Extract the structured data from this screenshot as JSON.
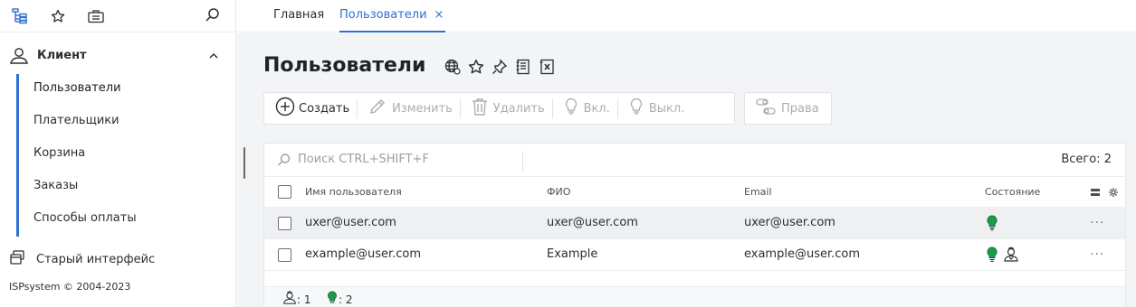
{
  "sidebar": {
    "section_label": "Клиент",
    "items": [
      {
        "label": "Пользователи"
      },
      {
        "label": "Плательщики"
      },
      {
        "label": "Корзина"
      },
      {
        "label": "Заказы"
      },
      {
        "label": "Способы оплаты"
      }
    ],
    "old_interface_label": "Старый интерфейс",
    "copyright": "ISPsystem © 2004-2023"
  },
  "tabs": {
    "home_label": "Главная",
    "users_label": "Пользователи",
    "close_symbol": "×"
  },
  "page": {
    "title": "Пользователи"
  },
  "toolbar": {
    "create": "Создать",
    "edit": "Изменить",
    "delete": "Удалить",
    "enable": "Вкл.",
    "disable": "Выкл.",
    "rights": "Права"
  },
  "table": {
    "search_placeholder": "Поиск CTRL+SHIFT+F",
    "total_label": "Всего: 2",
    "columns": [
      "Имя пользователя",
      "ФИО",
      "Email",
      "Состояние"
    ],
    "rows": [
      {
        "username": "uxer@user.com",
        "fio": "uxer@user.com",
        "email": "uxer@user.com",
        "state": [
          "enabled-icon"
        ]
      },
      {
        "username": "example@user.com",
        "fio": "Example",
        "email": "example@user.com",
        "state": [
          "enabled-icon",
          "admin-icon"
        ]
      }
    ],
    "more_symbol": "···",
    "footer": {
      "admin_count": ": 1",
      "enabled_count": ": 2"
    }
  },
  "colors": {
    "accent": "#2f6fd1",
    "enabled_green": "#1f9a4a",
    "disabled_grey": "#a9aeb3"
  }
}
